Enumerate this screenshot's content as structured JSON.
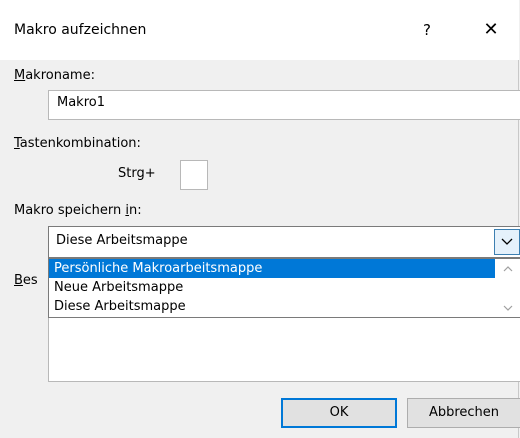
{
  "dialog": {
    "title": "Makro aufzeichnen",
    "help_glyph": "?",
    "close_glyph": "✕"
  },
  "macro_name": {
    "label_accel": "M",
    "label_rest": "akroname:",
    "value": "Makro1"
  },
  "shortcut": {
    "label_accel": "T",
    "label_rest": "astenkombination:",
    "prefix": "Strg+",
    "value": ""
  },
  "store_in": {
    "label_pre": "Makro speichern ",
    "label_accel": "i",
    "label_post": "n:",
    "selected": "Diese Arbeitsmappe",
    "options": [
      "Persönliche Makroarbeitsmappe",
      "Neue Arbeitsmappe",
      "Diese Arbeitsmappe"
    ],
    "highlighted_option": "Persönliche Makroarbeitsmappe"
  },
  "description": {
    "label_accel": "B",
    "label_rest": "es",
    "value": ""
  },
  "buttons": {
    "ok": "OK",
    "cancel": "Abbrechen"
  },
  "colors": {
    "accent": "#0078d7",
    "background": "#f0f0f0"
  }
}
